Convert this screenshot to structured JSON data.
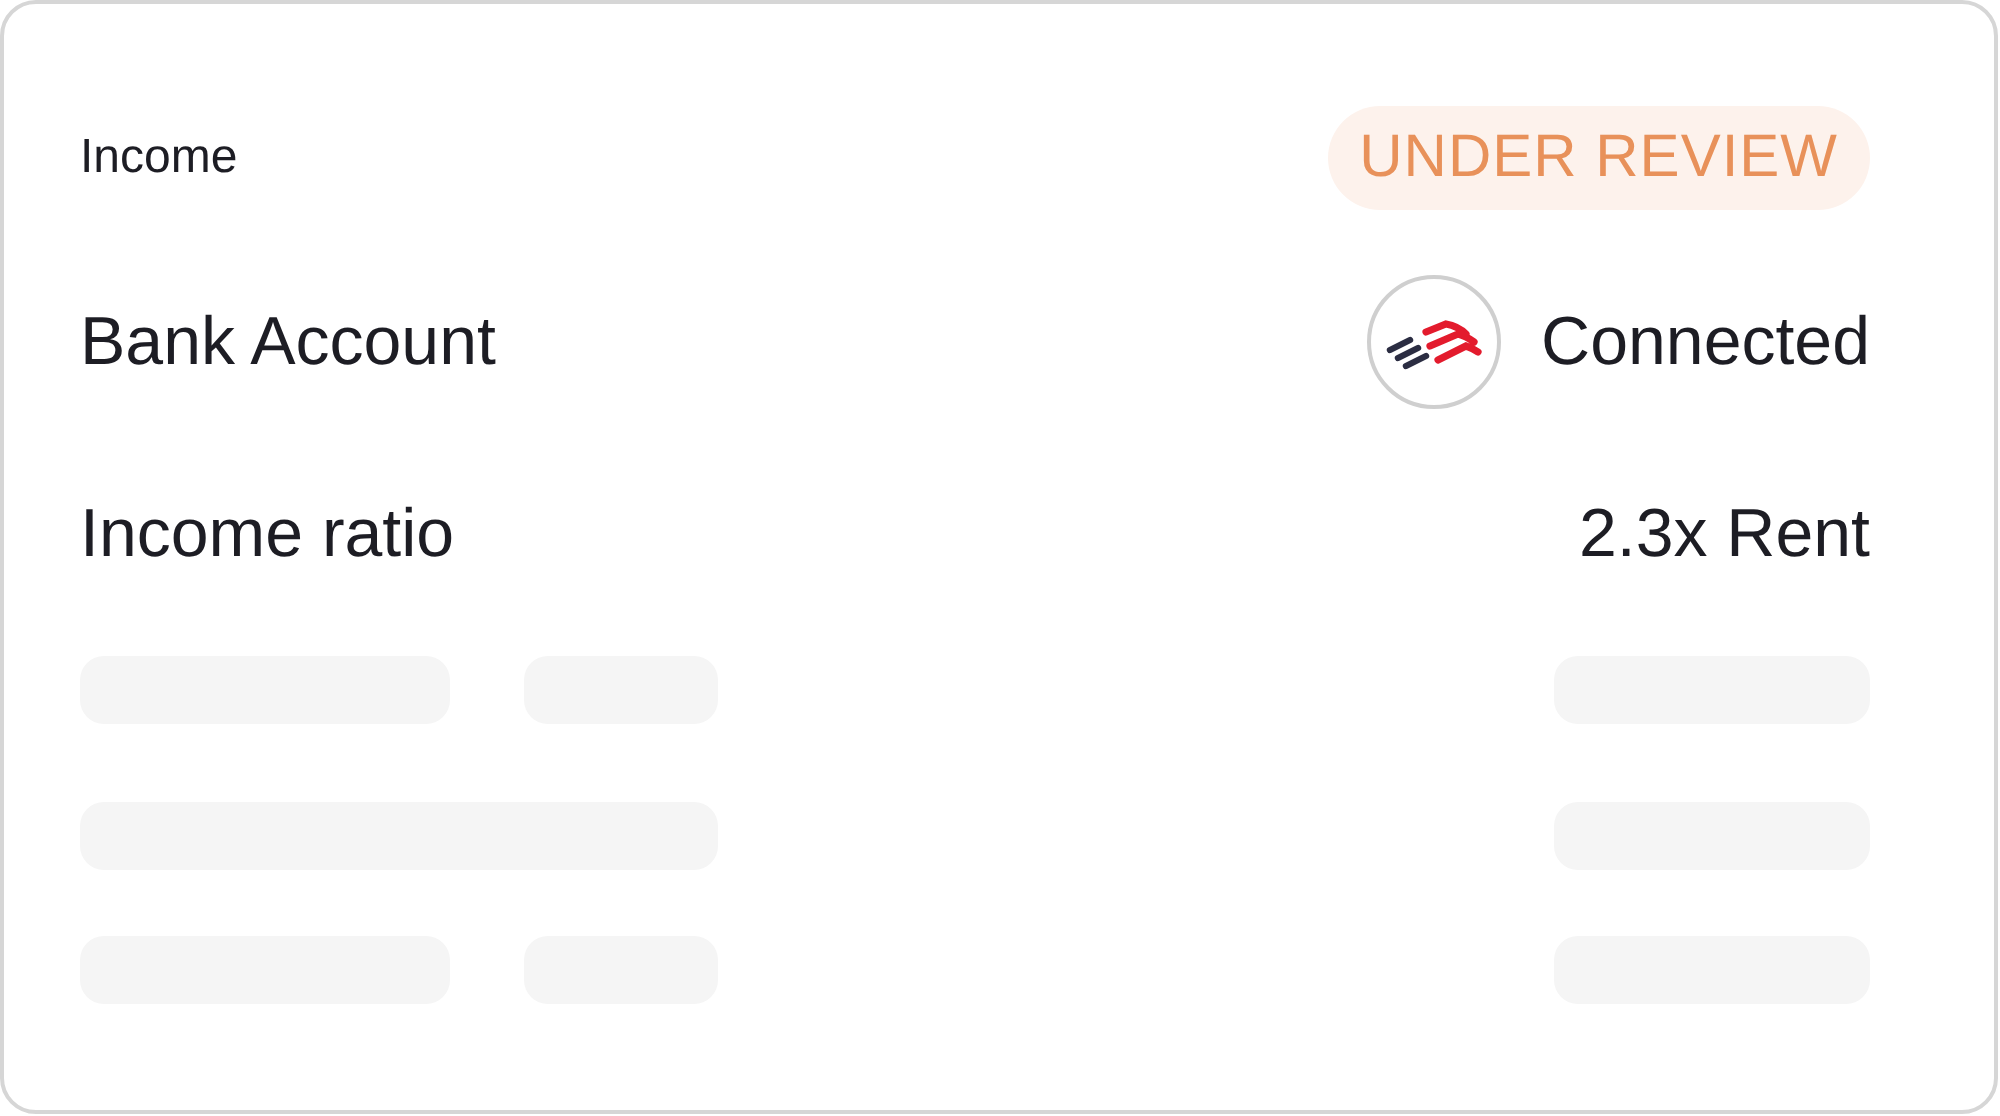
{
  "card": {
    "title": "Income",
    "status_badge": "UNDER REVIEW",
    "rows": [
      {
        "kind": "logo",
        "label": "Bank Account",
        "value": "Connected"
      },
      {
        "kind": "plain",
        "label": "Income ratio",
        "value": "2.3x Rent"
      }
    ],
    "placeholder_rows": [
      {
        "kind": "split"
      },
      {
        "kind": "wide"
      },
      {
        "kind": "split"
      }
    ]
  }
}
